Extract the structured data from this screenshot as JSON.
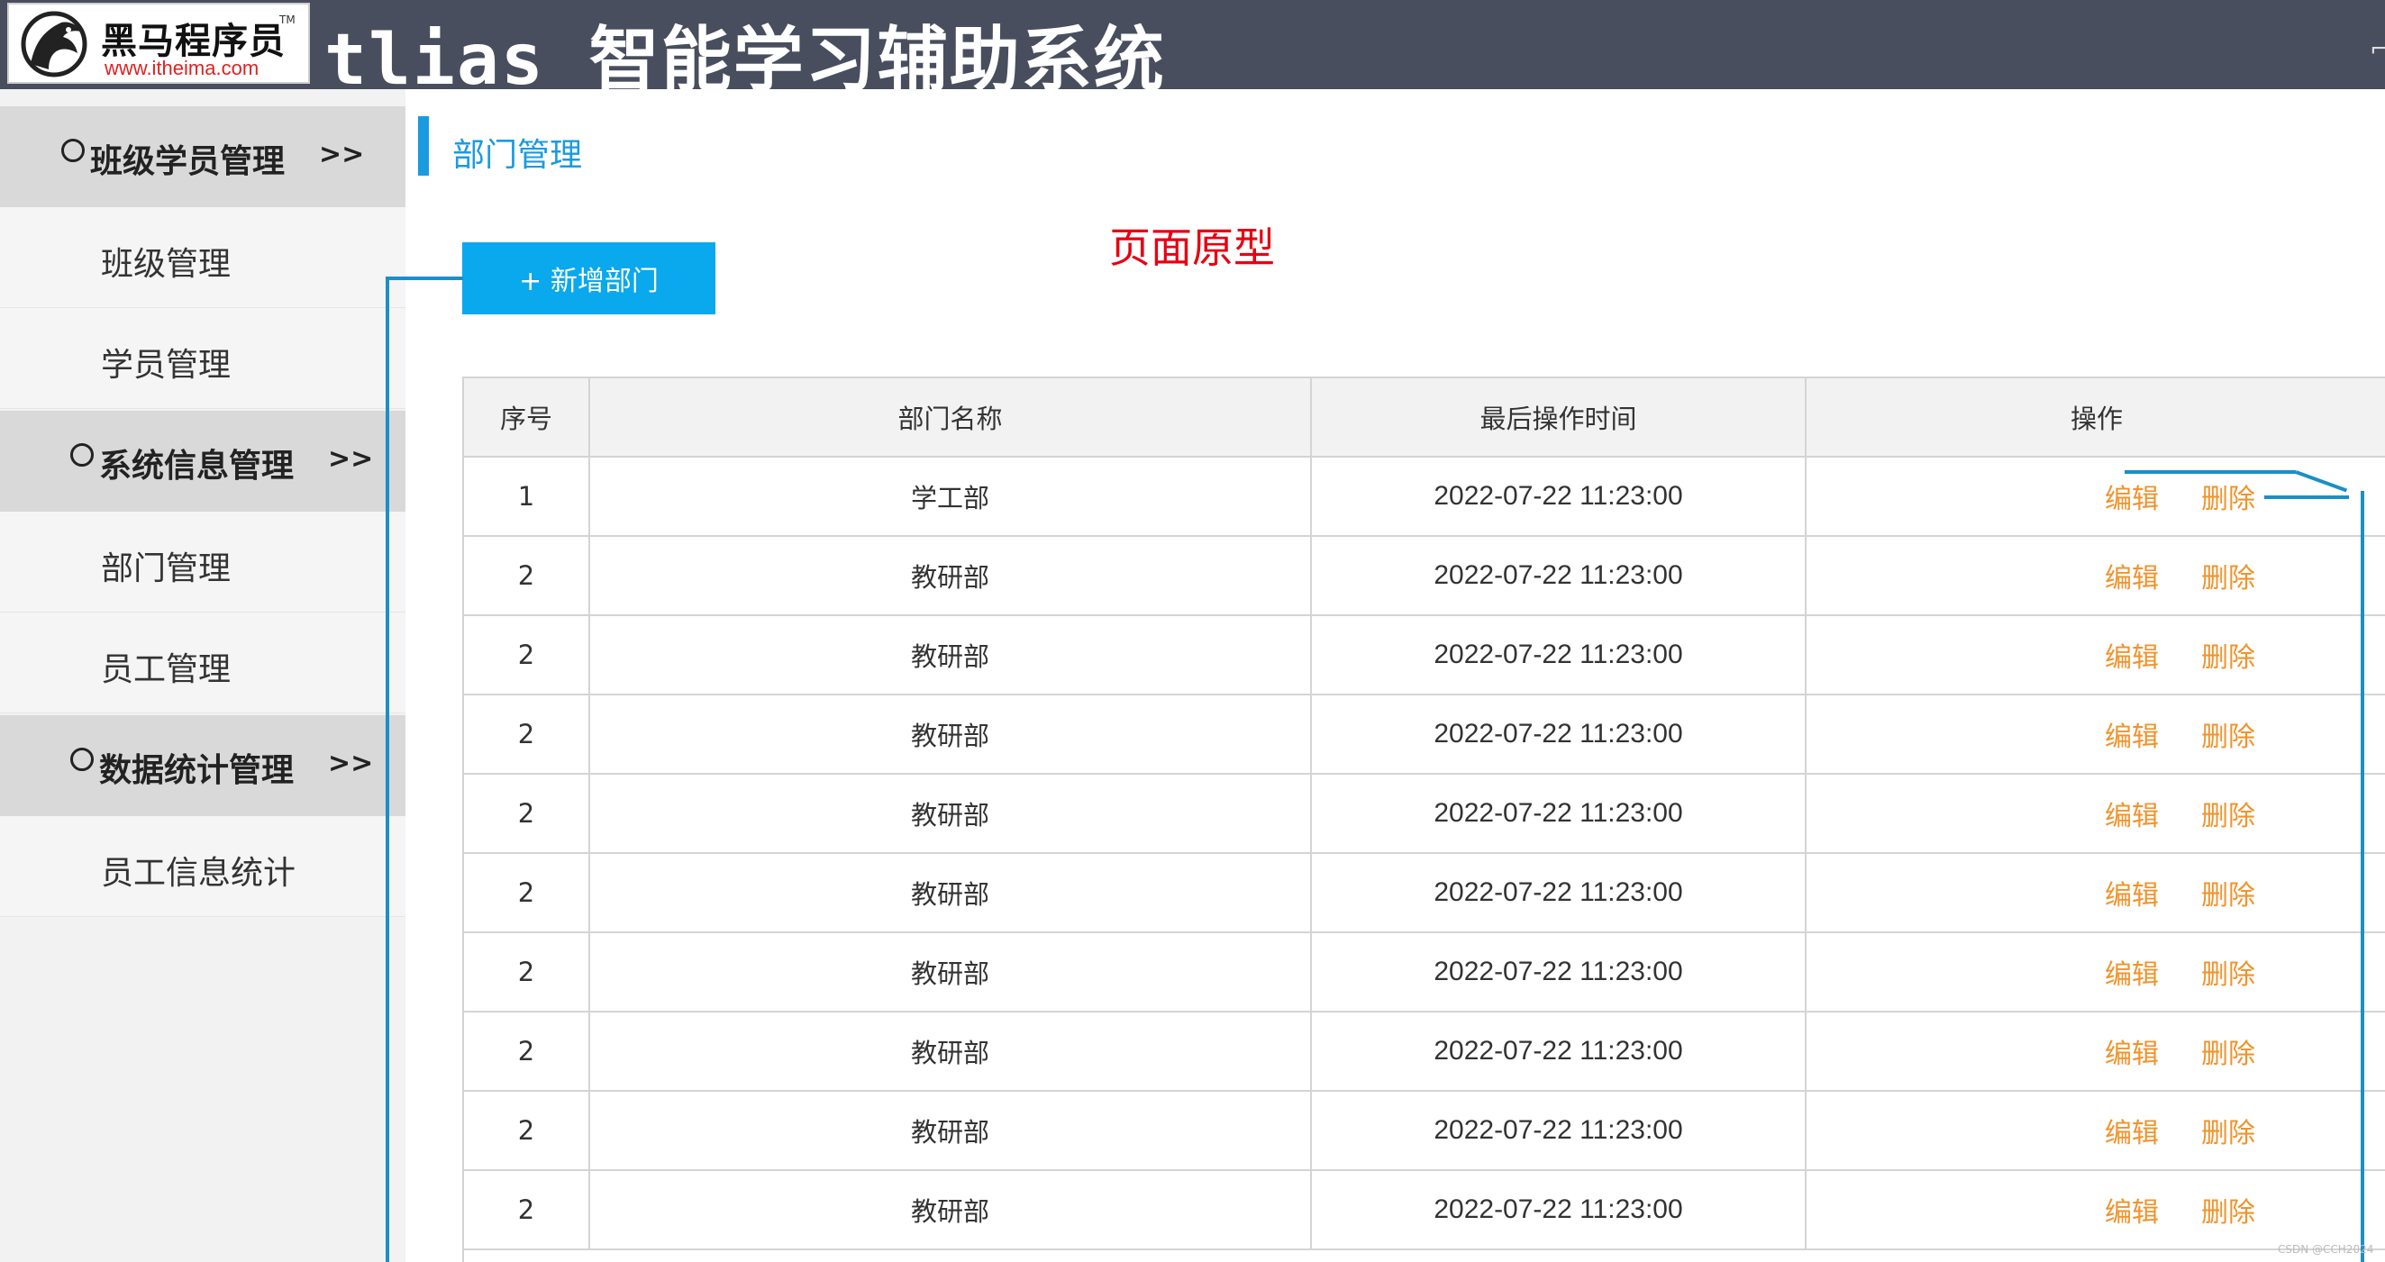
{
  "header": {
    "logo_text": "黑马程序员",
    "logo_tm": "TM",
    "logo_url": "www.itheima.com",
    "app_title": "tlias 智能学习辅助系统"
  },
  "sidebar": {
    "groups": [
      {
        "label": "班级学员管理",
        "arrow": ">>",
        "items": [
          "班级管理",
          "学员管理"
        ]
      },
      {
        "label": "系统信息管理",
        "arrow": ">>",
        "items": [
          "部门管理",
          "员工管理"
        ]
      },
      {
        "label": "数据统计管理",
        "arrow": ">>",
        "items": [
          "员工信息统计"
        ]
      }
    ]
  },
  "main": {
    "breadcrumb": "部门管理",
    "annotation": "页面原型",
    "add_button_label": "+ 新增部门",
    "table": {
      "columns": [
        "序号",
        "部门名称",
        "最后操作时间",
        "操作"
      ],
      "rows": [
        {
          "index": "1",
          "name": "学工部",
          "time": "2022-07-22 11:23:00",
          "edit": "编辑",
          "delete": "删除"
        },
        {
          "index": "2",
          "name": "教研部",
          "time": "2022-07-22 11:23:00",
          "edit": "编辑",
          "delete": "删除"
        },
        {
          "index": "2",
          "name": "教研部",
          "time": "2022-07-22 11:23:00",
          "edit": "编辑",
          "delete": "删除"
        },
        {
          "index": "2",
          "name": "教研部",
          "time": "2022-07-22 11:23:00",
          "edit": "编辑",
          "delete": "删除"
        },
        {
          "index": "2",
          "name": "教研部",
          "time": "2022-07-22 11:23:00",
          "edit": "编辑",
          "delete": "删除"
        },
        {
          "index": "2",
          "name": "教研部",
          "time": "2022-07-22 11:23:00",
          "edit": "编辑",
          "delete": "删除"
        },
        {
          "index": "2",
          "name": "教研部",
          "time": "2022-07-22 11:23:00",
          "edit": "编辑",
          "delete": "删除"
        },
        {
          "index": "2",
          "name": "教研部",
          "time": "2022-07-22 11:23:00",
          "edit": "编辑",
          "delete": "删除"
        },
        {
          "index": "2",
          "name": "教研部",
          "time": "2022-07-22 11:23:00",
          "edit": "编辑",
          "delete": "删除"
        },
        {
          "index": "2",
          "name": "教研部",
          "time": "2022-07-22 11:23:00",
          "edit": "编辑",
          "delete": "删除"
        }
      ]
    }
  },
  "watermark": "CSDN @CCH2024",
  "colors": {
    "header_bg": "#484e5e",
    "accent_blue": "#1a9be0",
    "button_blue": "#0aa8ec",
    "action_orange": "#f0932b",
    "annotation_red": "#e60012"
  }
}
